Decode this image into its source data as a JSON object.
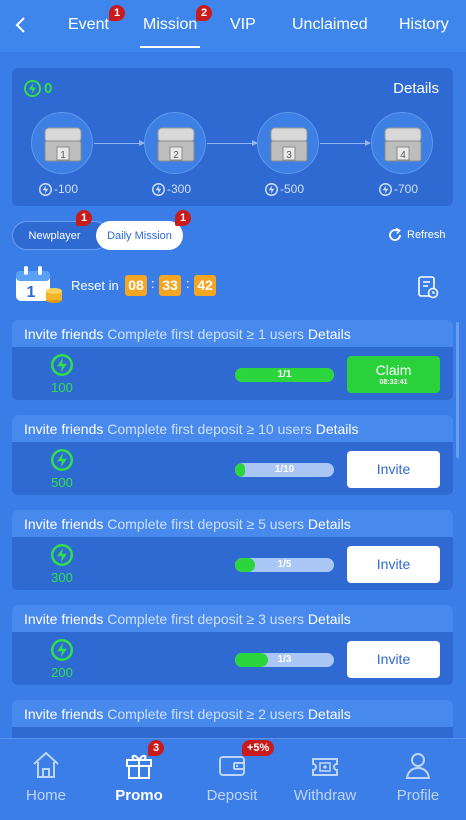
{
  "nav": {
    "tabs": [
      {
        "label": "Event",
        "badge": "1"
      },
      {
        "label": "Mission",
        "badge": "2"
      },
      {
        "label": "VIP"
      },
      {
        "label": "Unclaimed"
      },
      {
        "label": "History"
      }
    ],
    "active_tab": "Mission"
  },
  "chests": {
    "balance": "0",
    "details_label": "Details",
    "items": [
      {
        "number": "1",
        "cost": "-100"
      },
      {
        "number": "2",
        "cost": "-300"
      },
      {
        "number": "3",
        "cost": "-500"
      },
      {
        "number": "4",
        "cost": "-700"
      }
    ]
  },
  "mission_types": {
    "newplayer": {
      "label": "Newplayer",
      "badge": "1"
    },
    "daily": {
      "label": "Daily Mission",
      "badge": "1"
    },
    "refresh_label": "Refresh"
  },
  "reset": {
    "label": "Reset in",
    "hours": "08",
    "minutes": "33",
    "seconds": "42",
    "separator": ":"
  },
  "missions": [
    {
      "type": "Invite friends",
      "desc": "Complete first deposit ≥ 1 users",
      "details": "Details",
      "reward": "100",
      "progress_text": "1/1",
      "progress": 1.0,
      "button": "Claim",
      "button_sub": "08:33:41"
    },
    {
      "type": "Invite friends",
      "desc": "Complete first deposit ≥ 10 users",
      "details": "Details",
      "reward": "500",
      "progress_text": "1/10",
      "progress": 0.1,
      "button": "Invite"
    },
    {
      "type": "Invite friends",
      "desc": "Complete first deposit ≥ 5 users",
      "details": "Details",
      "reward": "300",
      "progress_text": "1/5",
      "progress": 0.2,
      "button": "Invite"
    },
    {
      "type": "Invite friends",
      "desc": "Complete first deposit ≥ 3 users",
      "details": "Details",
      "reward": "200",
      "progress_text": "1/3",
      "progress": 0.333,
      "button": "Invite"
    },
    {
      "type": "Invite friends",
      "desc": "Complete first deposit ≥ 2 users",
      "details": "Details"
    }
  ],
  "bottom_nav": {
    "items": [
      {
        "label": "Home",
        "icon": "home-icon"
      },
      {
        "label": "Promo",
        "icon": "gift-icon",
        "badge": "3"
      },
      {
        "label": "Deposit",
        "icon": "wallet-icon",
        "badge": "+5%"
      },
      {
        "label": "Withdraw",
        "icon": "withdraw-icon"
      },
      {
        "label": "Profile",
        "icon": "profile-icon"
      }
    ],
    "active": "Promo"
  },
  "colors": {
    "background": "#3a7de6",
    "panel": "#2f69d2",
    "energy_green": "#30e04b",
    "timer_orange": "#f4a623",
    "badge_red": "#c91b1b",
    "claim_green": "#2ad13a"
  }
}
